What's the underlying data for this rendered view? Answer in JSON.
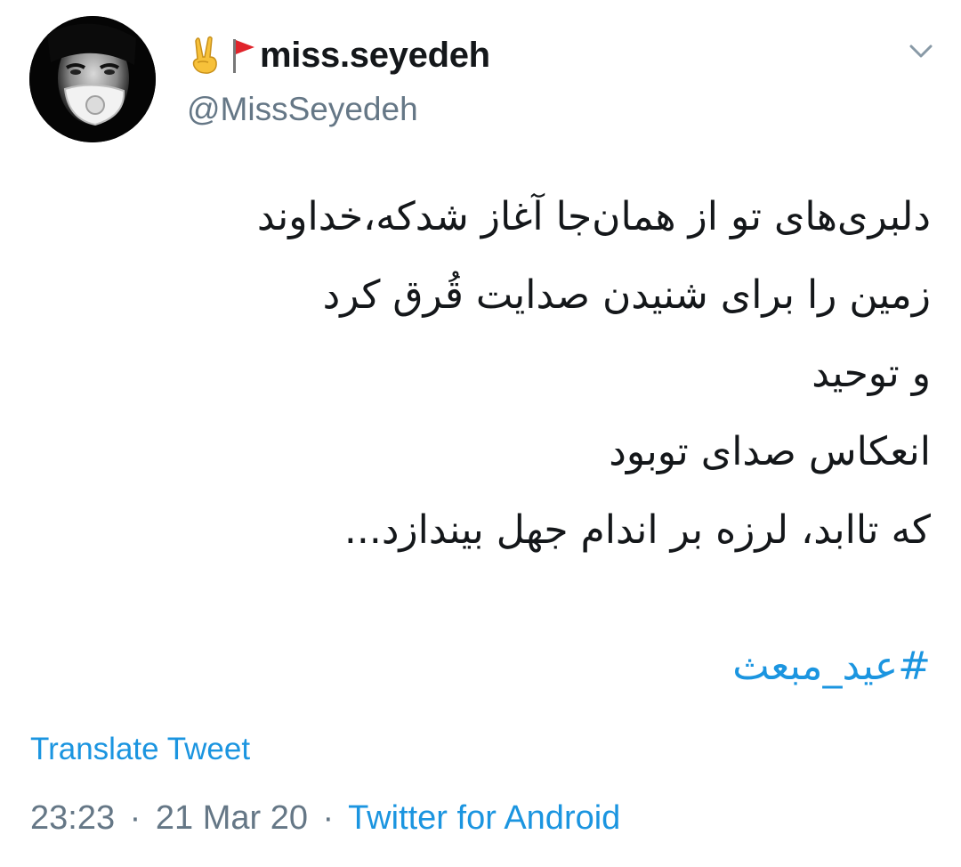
{
  "user": {
    "display_name": "miss.seyedeh",
    "handle": "@MissSeyedeh",
    "name_emojis": [
      "victory-hand-icon",
      "red-flag-icon"
    ]
  },
  "tweet": {
    "lines": [
      "دلبری‌های تو از همان‌جا آغاز شدکه،خداوند",
      "زمین را برای شنیدن صدایت قُرق کرد",
      "و توحید",
      "انعکاس صدای توبود",
      "که تاابد، لرزه بر اندام جهل بیندازد..."
    ],
    "hashtag": "#عید_مبعث"
  },
  "actions": {
    "translate_label": "Translate Tweet"
  },
  "meta": {
    "time": "23:23",
    "date": "21 Mar 20",
    "separator": "·",
    "source": "Twitter for Android"
  },
  "colors": {
    "link": "#1b95e0",
    "secondary_text": "#657786",
    "primary_text": "#14171a"
  }
}
